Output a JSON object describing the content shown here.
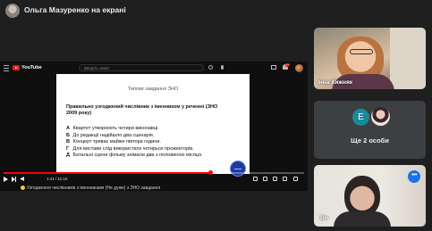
{
  "presenter": {
    "label": "Ольга Мазуренко на екрані"
  },
  "youtube": {
    "logo_text": "YouTube",
    "search_placeholder": "Введіть запит",
    "notification_count": "9+",
    "video_time": "1:41 / 11:10",
    "progress": 0.69
  },
  "slide": {
    "heading": "Типове завдання ЗНО",
    "question": "Правильно узгоджений числівник з іменником у реченні (ЗНО 2009 року)",
    "options": [
      {
        "letter": "А",
        "text": "Квартет утворюють чотири виконавці."
      },
      {
        "letter": "Б",
        "text": "До редакції надійшло два сценарія."
      },
      {
        "letter": "В",
        "text": "Концерт триває майже півтора години."
      },
      {
        "letter": "Г",
        "text": "Для вистави слід використати чотирьох прожекторів."
      },
      {
        "letter": "Д",
        "text": "Батальні сцени фільму знімали два з половиною місяця."
      }
    ]
  },
  "share_overlay": {
    "text": "Узгодження числівників з іменниками (Не дуже) з ЗНО завдання"
  },
  "participants": {
    "inna": {
      "name": "Інна Хижняк"
    },
    "others": {
      "avatar_letter": "Е",
      "label": "Ще 2 особи"
    },
    "self": {
      "name": "Ви",
      "more_label": "•••"
    }
  },
  "colors": {
    "background": "#1f1f20",
    "youtube_red": "#ff0000",
    "tile_gray": "#3c4043",
    "avatar_teal": "#1a8a9a",
    "meet_blue": "#1a73e8"
  }
}
